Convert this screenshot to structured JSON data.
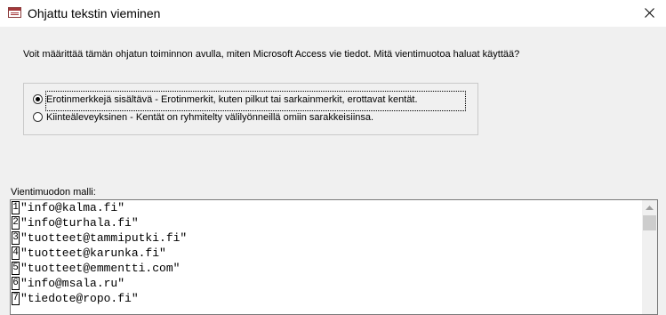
{
  "window": {
    "title": "Ohjattu tekstin vieminen",
    "app_icon": "access-form-icon",
    "close_icon": "close-icon"
  },
  "intro_text": "Voit määrittää tämän ohjatun toiminnon avulla, miten Microsoft Access vie tiedot. Mitä vientimuotoa haluat käyttää?",
  "format_options": [
    {
      "label": "Erotinmerkkejä sisältävä - Erotinmerkit, kuten pilkut tai sarkainmerkit, erottavat kentät.",
      "selected": true
    },
    {
      "label": "Kiinteäleveyksinen - Kentät on ryhmitelty välilyönneillä omiin sarakkeisiinsa.",
      "selected": false
    }
  ],
  "preview": {
    "label": "Vientimuodon malli:",
    "rows": [
      {
        "num": "1",
        "value": "\"info@kalma.fi\""
      },
      {
        "num": "2",
        "value": "\"info@turhala.fi\""
      },
      {
        "num": "3",
        "value": "\"tuotteet@tammiputki.fi\""
      },
      {
        "num": "4",
        "value": "\"tuotteet@karunka.fi\""
      },
      {
        "num": "5",
        "value": "\"tuotteet@emmentti.com\""
      },
      {
        "num": "6",
        "value": "\"info@msala.ru\""
      },
      {
        "num": "7",
        "value": "\"tiedote@ropo.fi\""
      }
    ],
    "scroll_up_icon": "scroll-up-arrow-icon"
  },
  "colors": {
    "background": "#f0f0f0",
    "titlebar": "#ffffff",
    "icon_accent": "#a4373a"
  }
}
